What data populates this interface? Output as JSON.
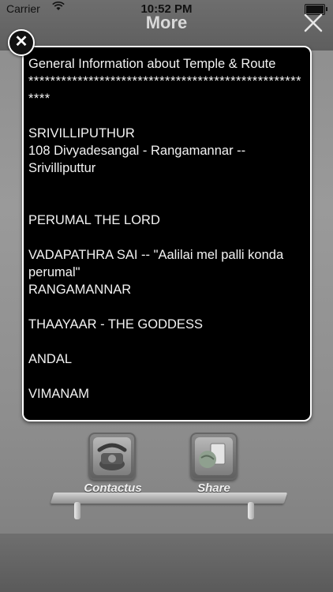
{
  "status_bar": {
    "carrier": "Carrier",
    "time": "10:52 PM"
  },
  "nav": {
    "title": "More"
  },
  "popup": {
    "heading": "General Information about Temple & Route",
    "stars": "******************************************************",
    "lines": [
      "SRIVILLIPUTHUR",
      "108 Divyadesangal - Rangamannar -- Srivilliputtur",
      "",
      "",
      "PERUMAL THE LORD",
      "",
      "VADAPATHRA SAI -- \"Aalilai mel palli konda perumal\"",
      "RANGAMANNAR",
      "",
      "THAAYAAR - THE GODDESS",
      "",
      "ANDAL",
      "",
      "VIMANAM"
    ]
  },
  "shelf": {
    "items": [
      {
        "label": "Contactus",
        "icon": "telephone-icon"
      },
      {
        "label": "Share",
        "icon": "share-icon"
      }
    ]
  }
}
